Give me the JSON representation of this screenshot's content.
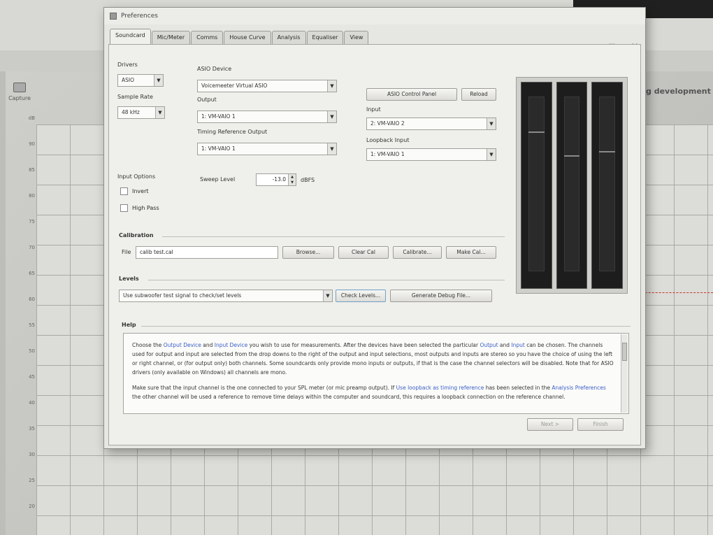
{
  "background": {
    "capture_label": "Capture",
    "heading": "g development",
    "y_ticks": [
      "dB",
      "90",
      "85",
      "80",
      "75",
      "70",
      "65",
      "60",
      "55",
      "50",
      "45",
      "40",
      "35",
      "30",
      "25",
      "20"
    ]
  },
  "window": {
    "title": "Preferences",
    "controls": [
      "—",
      "□",
      "✕"
    ],
    "tabs": [
      "Soundcard",
      "Mic/Meter",
      "Comms",
      "House Curve",
      "Analysis",
      "Equaliser",
      "View"
    ]
  },
  "soundcard": {
    "drivers_label": "Drivers",
    "drivers_value": "ASIO",
    "sample_rate_label": "Sample Rate",
    "sample_rate_value": "48 kHz",
    "asio_device_label": "ASIO Device",
    "asio_device_value": "Voicemeeter Virtual ASIO",
    "output_label": "Output",
    "output_value": "1: VM-VAIO 1",
    "timing_ref_label": "Timing Reference Output",
    "timing_ref_value": "1: VM-VAIO 1",
    "asio_control_panel": "ASIO Control Panel",
    "reload": "Reload",
    "input_label": "Input",
    "input_value": "2: VM-VAIO 2",
    "loopback_label": "Loopback Input",
    "loopback_value": "1: VM-VAIO 1",
    "input_options_label": "Input Options",
    "invert_label": "Invert",
    "high_pass_label": "High Pass",
    "sweep_level_label": "Sweep Level",
    "sweep_level_value": "-13.0",
    "sweep_level_unit": "dBFS"
  },
  "calibration": {
    "section_label": "Calibration",
    "file_label": "File",
    "file_value": "calib test.cal",
    "browse": "Browse...",
    "clear_cal": "Clear Cal",
    "calibrate": "Calibrate...",
    "make_cal": "Make Cal..."
  },
  "levels": {
    "section_label": "Levels",
    "select_value": "Use subwoofer test signal to check/set levels",
    "check_levels": "Check Levels...",
    "generate_debug": "Generate Debug File..."
  },
  "help": {
    "section_label": "Help",
    "p1_a": "Choose the ",
    "p1_link1": "Output Device",
    "p1_b": " and ",
    "p1_link2": "Input Device",
    "p1_c": " you wish to use for measurements. After the devices have been selected the particular ",
    "p1_link3": "Output",
    "p1_d": " and ",
    "p1_link4": "Input",
    "p1_e": " can be chosen. The channels used for output and input are selected from the drop downs to the right of the output and input selections, most outputs and inputs are stereo so you have the choice of using the left or right channel, or (for output only) both channels. Some soundcards only provide mono inputs or outputs, if that is the case the channel selectors will be disabled. Note that for ASIO drivers (only available on Windows) all channels are mono.",
    "p2_a": "Make sure that the input channel is the one connected to your SPL meter (or mic preamp output). If ",
    "p2_link1": "Use loopback as timing reference",
    "p2_b": " has been selected in the ",
    "p2_link2": "Analysis Preferences",
    "p2_c": " the other channel will be used a reference to remove time delays within the computer and soundcard, this requires a loopback connection on the reference channel."
  },
  "footer": {
    "next": "Next >",
    "finish": "Finish"
  }
}
